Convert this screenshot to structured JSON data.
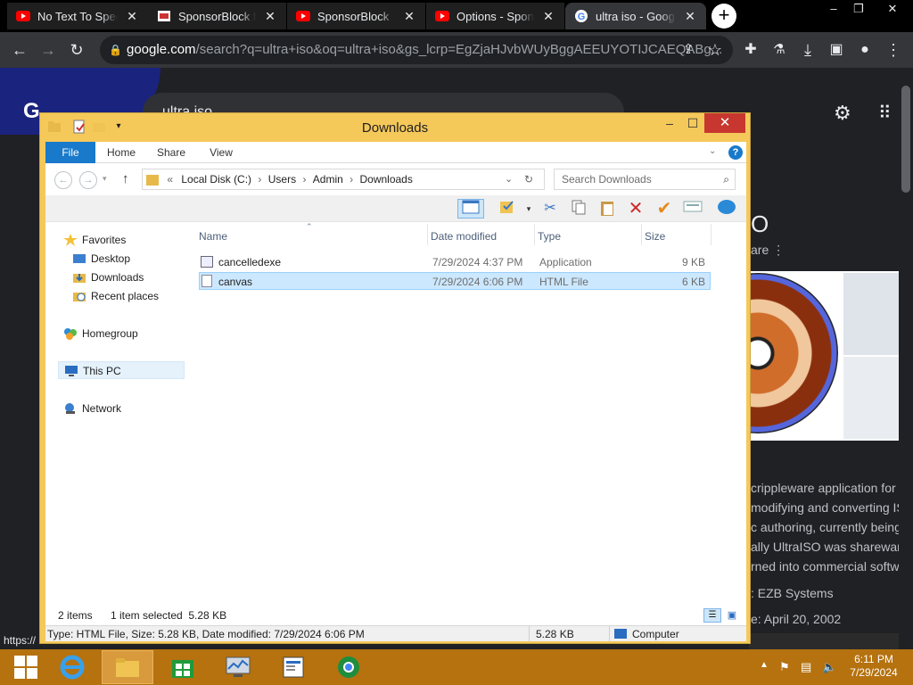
{
  "browser": {
    "tabs": [
      {
        "label": "No Text To Speech",
        "icon": "youtube-icon"
      },
      {
        "label": "SponsorBlock for YouTube",
        "icon": "sponsorblock-icon"
      },
      {
        "label": "SponsorBlock",
        "icon": "youtube-icon"
      },
      {
        "label": "Options - SponsorBlock",
        "icon": "youtube-icon"
      },
      {
        "label": "ultra iso - Google Search",
        "icon": "google-icon",
        "active": true
      }
    ],
    "address": {
      "host": "google.com",
      "path": "/search?q=ultra+iso&oq=ultra+iso&gs_lcrp=EgZjaHJvbWUyBggAEEUYOTIJCAEQABg..."
    },
    "status_url": "https://"
  },
  "google_page": {
    "search_query": "ultra iso",
    "knowledge_snippets": [
      "crippleware application for",
      "modifying and converting IS",
      "c authoring, currently being",
      "ally UltraISO was sharewar",
      "rned into commercial softw"
    ],
    "developer_fragment": ": EZB Systems",
    "release_fragment": "e: April 20, 2002",
    "share_fragment": "are",
    "title_fragment": "O"
  },
  "explorer": {
    "title": "Downloads",
    "ribbon_tabs": [
      "File",
      "Home",
      "Share",
      "View"
    ],
    "address_parts": [
      "Local Disk (C:)",
      "Users",
      "Admin",
      "Downloads"
    ],
    "search_placeholder": "Search Downloads",
    "nav": {
      "favorites": "Favorites",
      "desktop": "Desktop",
      "downloads": "Downloads",
      "recent": "Recent places",
      "homegroup": "Homegroup",
      "thispc": "This PC",
      "network": "Network"
    },
    "columns": {
      "name": "Name",
      "date": "Date modified",
      "type": "Type",
      "size": "Size"
    },
    "files": [
      {
        "name": "cancelledexe",
        "date": "7/29/2024 4:37 PM",
        "type": "Application",
        "size": "9 KB"
      },
      {
        "name": "canvas",
        "date": "7/29/2024 6:06 PM",
        "type": "HTML File",
        "size": "6 KB",
        "selected": true
      }
    ],
    "status": {
      "items": "2 items",
      "selected": "1 item selected  5.28 KB"
    },
    "details_bar": {
      "info": "Type: HTML File, Size: 5.28 KB, Date modified: 7/29/2024 6:06 PM",
      "size": "5.28 KB",
      "location": "Computer"
    }
  },
  "taskbar": {
    "time": "6:11 PM",
    "date": "7/29/2024"
  },
  "colors": {
    "explorer_frame": "#f5c85a",
    "taskbar": "#b5720f",
    "selection": "#cce8ff",
    "close_button": "#c7372f",
    "file_tab": "#1979ca"
  }
}
